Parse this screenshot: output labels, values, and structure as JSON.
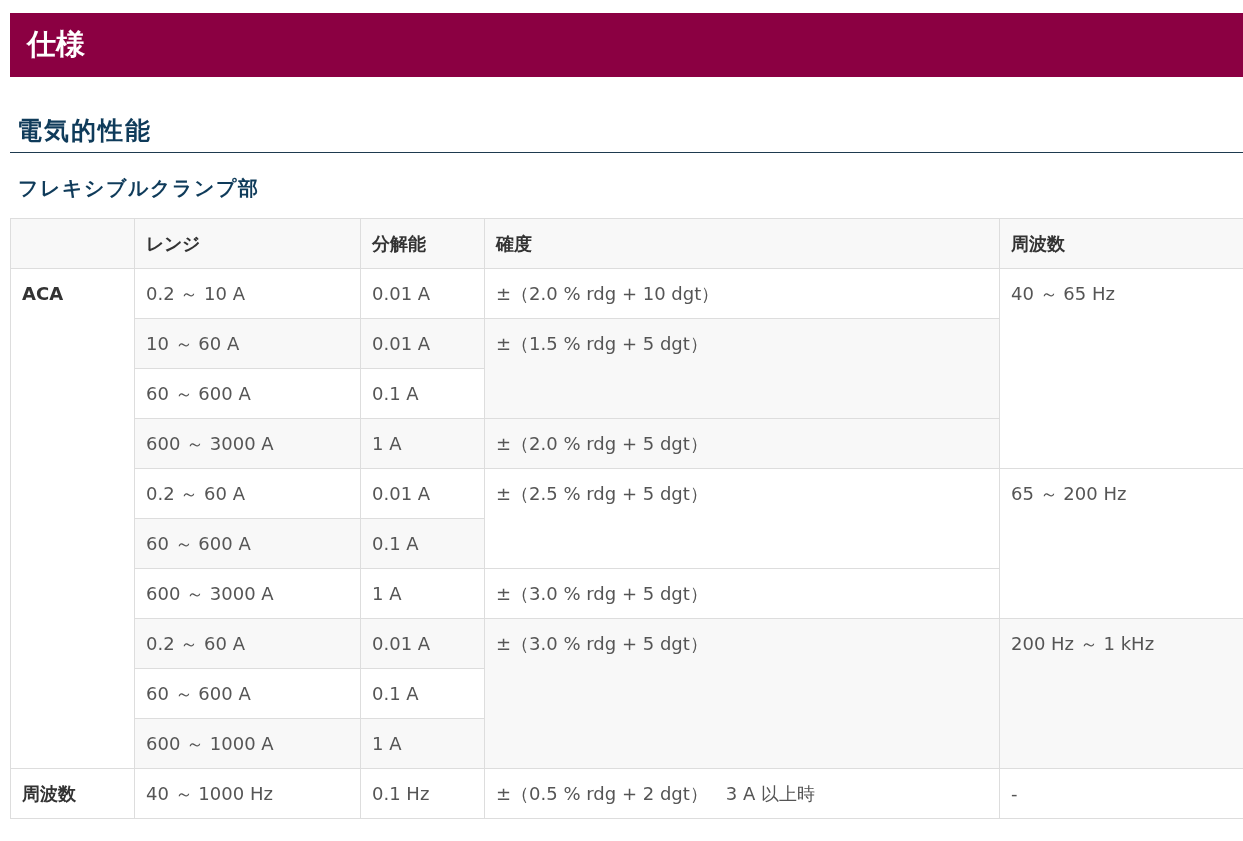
{
  "page_title": "仕様",
  "section_heading": "電気的性能",
  "subsection_heading": "フレキシブルクランプ部",
  "table": {
    "columns": [
      "レンジ",
      "分解能",
      "確度",
      "周波数"
    ],
    "groups": [
      {
        "label": "ACA",
        "bands": [
          {
            "frequency": "40 ～ 65 Hz",
            "accuracies": [
              {
                "accuracy": "±（2.0 % rdg + 10 dgt）",
                "ranges": [
                  {
                    "range": "0.2 ～ 10 A",
                    "resolution": "0.01 A"
                  }
                ]
              },
              {
                "accuracy": "±（1.5 % rdg + 5 dgt）",
                "ranges": [
                  {
                    "range": "10 ～ 60 A",
                    "resolution": "0.01 A"
                  },
                  {
                    "range": "60 ～ 600 A",
                    "resolution": "0.1 A"
                  }
                ]
              },
              {
                "accuracy": "±（2.0 % rdg + 5 dgt）",
                "ranges": [
                  {
                    "range": "600 ～ 3000 A",
                    "resolution": "1 A"
                  }
                ]
              }
            ]
          },
          {
            "frequency": "65 ～ 200 Hz",
            "accuracies": [
              {
                "accuracy": "±（2.5 % rdg + 5 dgt）",
                "ranges": [
                  {
                    "range": "0.2 ～ 60 A",
                    "resolution": "0.01 A"
                  },
                  {
                    "range": "60 ～ 600 A",
                    "resolution": "0.1 A"
                  }
                ]
              },
              {
                "accuracy": "±（3.0 % rdg + 5 dgt）",
                "ranges": [
                  {
                    "range": "600 ～ 3000 A",
                    "resolution": "1 A"
                  }
                ]
              }
            ]
          },
          {
            "frequency": "200 Hz ～ 1 kHz",
            "accuracies": [
              {
                "accuracy": "±（3.0 % rdg + 5 dgt）",
                "ranges": [
                  {
                    "range": "0.2 ～ 60 A",
                    "resolution": "0.01 A"
                  },
                  {
                    "range": "60 ～ 600 A",
                    "resolution": "0.1 A"
                  },
                  {
                    "range": "600 ～ 1000 A",
                    "resolution": "1 A"
                  }
                ]
              }
            ]
          }
        ]
      },
      {
        "label": "周波数",
        "bands": [
          {
            "frequency": "-",
            "accuracies": [
              {
                "accuracy": "±（0.5 % rdg + 2 dgt）　3 A 以上時",
                "ranges": [
                  {
                    "range": "40 ～ 1000 Hz",
                    "resolution": "0.1 Hz"
                  }
                ]
              }
            ]
          }
        ]
      }
    ]
  }
}
